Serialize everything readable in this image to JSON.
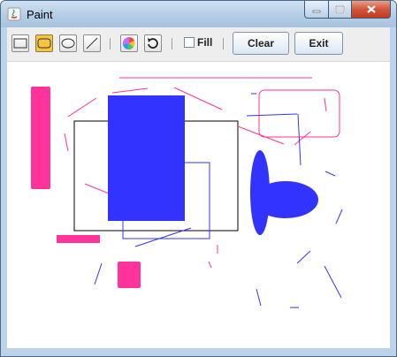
{
  "window": {
    "title": "Paint"
  },
  "toolbar": {
    "tools": [
      {
        "name": "rectangle-tool",
        "selected": false
      },
      {
        "name": "rounded-rectangle-tool",
        "selected": true
      },
      {
        "name": "oval-tool",
        "selected": false
      },
      {
        "name": "line-tool",
        "selected": false
      }
    ],
    "fill_label": "Fill",
    "fill_checked": false,
    "clear_label": "Clear",
    "exit_label": "Exit"
  },
  "colors": {
    "pink": "#ff3399",
    "blue": "#3333ff",
    "black": "#000000",
    "selected_tool": "#f5c542"
  }
}
